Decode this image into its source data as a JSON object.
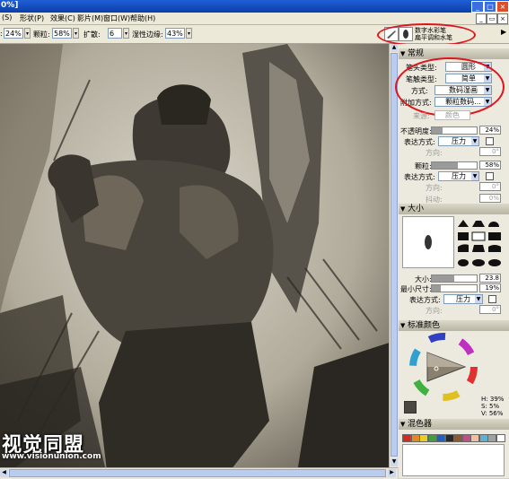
{
  "window": {
    "title_fragment": "0%]"
  },
  "menu": {
    "items": [
      "(S)",
      "形状(P)",
      "效果(C)",
      "影片(M)",
      "窗口(W)",
      "帮助(H)"
    ]
  },
  "property_bar": {
    "opacity_value": "24%",
    "grain_label": "颗粒:",
    "grain_value": "58%",
    "spread_label": "扩散:",
    "spread_value": "6",
    "edge_label": "湿性边缘:",
    "edge_value": "43%",
    "variant_line1": "数字水彩笔",
    "variant_line2": "扁平调和水笔"
  },
  "general": {
    "header": "常规",
    "dab_label": "笔头类型:",
    "dab_value": "圆形",
    "stroke_label": "笔触类型:",
    "stroke_value": "简单",
    "method_label": "方式:",
    "method_value": "数码湿画",
    "subcategory_label": "附加方式:",
    "subcategory_value": "颗粒数码...",
    "source_label": "来源:",
    "source_value": "颜色",
    "opacity_label": "不透明度:",
    "opacity_value": "24%",
    "opacity_fraction": 0.24,
    "expression_label": "表达方式:",
    "expression_value": "压力",
    "direction_label": "方向:",
    "direction_value": "0°",
    "grain_label": "颗粒:",
    "grain_value": "58%",
    "grain_fraction": 0.58,
    "expression2_label": "表达方式:",
    "expression2_value": "压力",
    "direction2_label": "方向:",
    "direction2_value": "0°",
    "jitter_label": "抖动:",
    "jitter_value": "0%"
  },
  "size": {
    "header": "大小",
    "size_label": "大小:",
    "size_value": "23.8",
    "size_fraction": 0.5,
    "min_label": "最小尺寸:",
    "min_value": "19%",
    "min_fraction": 0.19,
    "expression_label": "表达方式:",
    "expression_value": "压力",
    "direction_label": "方向:",
    "direction_value": "0°"
  },
  "color": {
    "header": "标准颜色",
    "h_label": "H:",
    "h_value": "39%",
    "s_label": "S:",
    "s_value": "5%",
    "v_label": "V:",
    "v_value": "56%",
    "primary": "#4a4640",
    "secondary": "#ffffff"
  },
  "color_set": {
    "header": "混色器",
    "swatches": [
      "#d42a20",
      "#e08a20",
      "#e8d020",
      "#40a040",
      "#2060c0",
      "#2a2a2a",
      "#8a5a30",
      "#c05080",
      "#f0c0a0",
      "#60b0d0",
      "#a0a0a0",
      "#ffffff"
    ]
  },
  "watermark": {
    "logo_text": "视觉同盟",
    "url_text": "www.visionunion.com"
  }
}
